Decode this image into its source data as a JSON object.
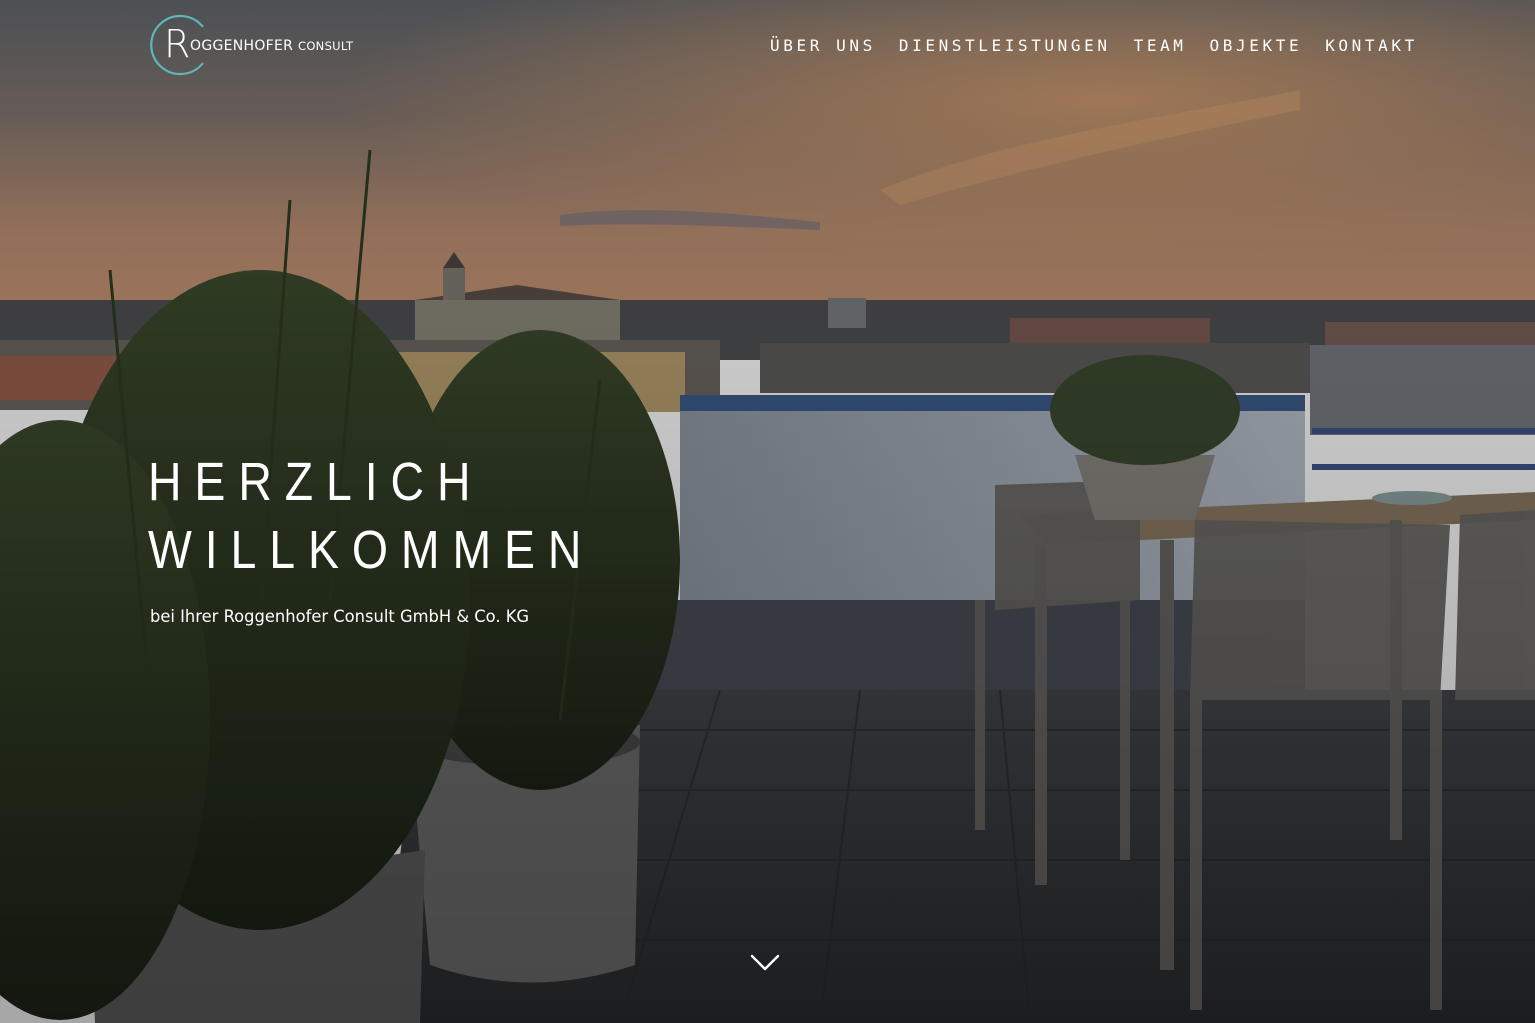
{
  "brand": {
    "logo_initial": "R",
    "logo_name_first": "OGGENHOFER",
    "logo_name_second": "CONSULT",
    "ring_color": "#5fb5b7"
  },
  "nav": {
    "items": [
      {
        "label": "ÜBER UNS"
      },
      {
        "label": "DIENSTLEISTUNGEN"
      },
      {
        "label": "TEAM"
      },
      {
        "label": "OBJEKTE"
      },
      {
        "label": "KONTAKT"
      }
    ]
  },
  "hero": {
    "headline_line1": "HERZLICH",
    "headline_line2": "WILLKOMMEN",
    "subline": "bei Ihrer Roggenhofer Consult GmbH & Co. KG",
    "scroll_icon": "chevron-down-icon"
  },
  "colors": {
    "text": "#ffffff",
    "accent": "#5fb5b7"
  }
}
